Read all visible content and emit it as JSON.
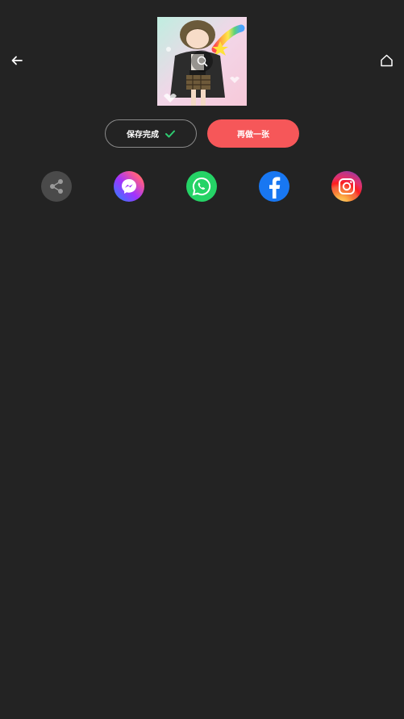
{
  "header": {
    "back_icon": "arrow-left-icon",
    "home_icon": "home-icon"
  },
  "preview": {
    "zoom_icon": "search-icon"
  },
  "actions": {
    "saved_label": "保存完成",
    "saved_icon": "check-icon",
    "redo_label": "再做一张"
  },
  "share": {
    "items": [
      {
        "name": "share",
        "icon": "share-icon",
        "color": "#4a4a4a"
      },
      {
        "name": "messenger",
        "icon": "messenger-icon",
        "color": "#a033ff"
      },
      {
        "name": "whatsapp",
        "icon": "whatsapp-icon",
        "color": "#25d366"
      },
      {
        "name": "facebook",
        "icon": "facebook-icon",
        "color": "#1877f2"
      },
      {
        "name": "instagram",
        "icon": "instagram-icon",
        "color": "#e1306c"
      }
    ]
  },
  "colors": {
    "background": "#232323",
    "accent": "#f65759",
    "check": "#2ecc71"
  }
}
